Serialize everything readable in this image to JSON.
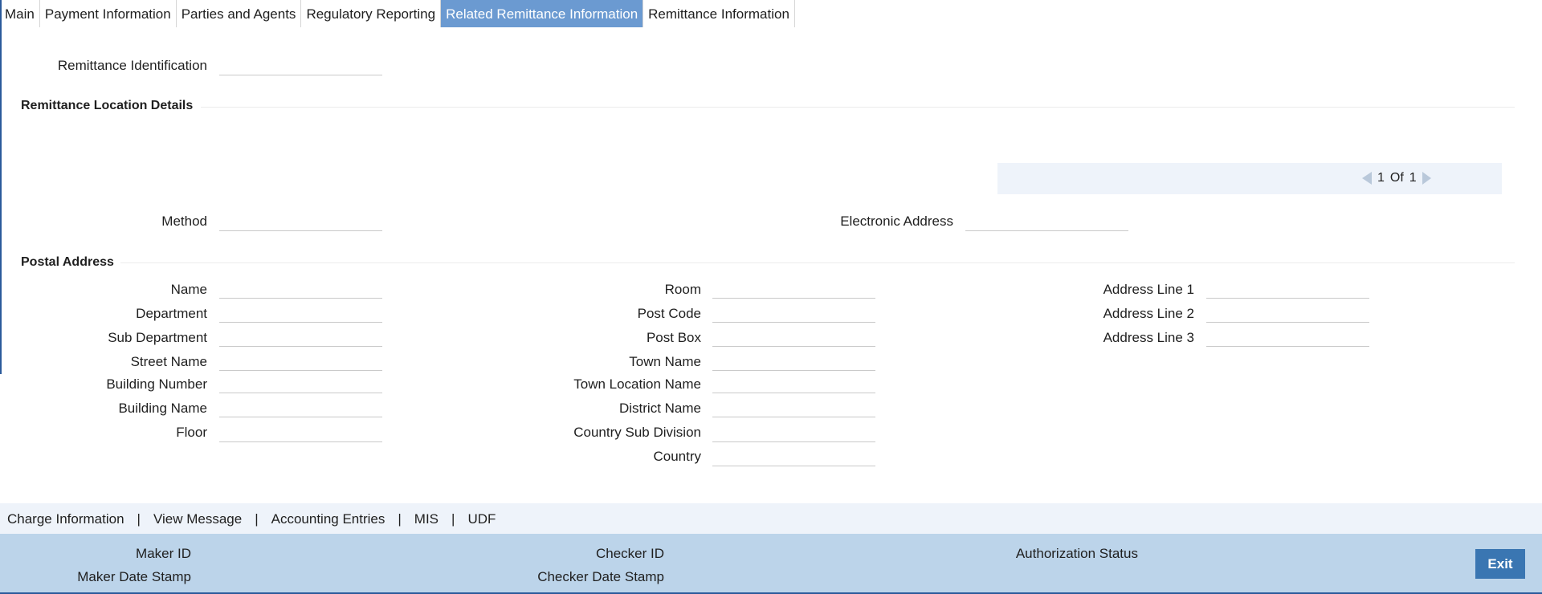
{
  "tabs": [
    {
      "label": "Main",
      "active": false
    },
    {
      "label": "Payment Information",
      "active": false
    },
    {
      "label": "Parties and Agents",
      "active": false
    },
    {
      "label": "Regulatory Reporting",
      "active": false
    },
    {
      "label": "Related Remittance Information",
      "active": true
    },
    {
      "label": "Remittance Information",
      "active": false
    }
  ],
  "remittance": {
    "identification_label": "Remittance Identification",
    "identification_value": ""
  },
  "location": {
    "title": "Remittance Location Details",
    "pager": {
      "current": "1",
      "of_label": "Of",
      "total": "1"
    },
    "method_label": "Method",
    "method_value": "",
    "electronic_address_label": "Electronic Address",
    "electronic_address_value": ""
  },
  "postal": {
    "title": "Postal Address",
    "col1": [
      {
        "label": "Name",
        "value": ""
      },
      {
        "label": "Department",
        "value": ""
      },
      {
        "label": "Sub Department",
        "value": ""
      },
      {
        "label": "Street Name",
        "value": ""
      },
      {
        "label": "Building Number",
        "value": ""
      },
      {
        "label": "Building Name",
        "value": ""
      },
      {
        "label": "Floor",
        "value": ""
      }
    ],
    "col2": [
      {
        "label": "Room",
        "value": ""
      },
      {
        "label": "Post Code",
        "value": ""
      },
      {
        "label": "Post Box",
        "value": ""
      },
      {
        "label": "Town Name",
        "value": ""
      },
      {
        "label": "Town Location Name",
        "value": ""
      },
      {
        "label": "District Name",
        "value": ""
      },
      {
        "label": "Country Sub Division",
        "value": ""
      },
      {
        "label": "Country",
        "value": ""
      }
    ],
    "col3": [
      {
        "label": "Address Line 1",
        "value": ""
      },
      {
        "label": "Address Line 2",
        "value": ""
      },
      {
        "label": "Address Line 3",
        "value": ""
      }
    ]
  },
  "links": {
    "charge_information": "Charge Information",
    "view_message": "View Message",
    "accounting_entries": "Accounting Entries",
    "mis": "MIS",
    "udf": "UDF",
    "separator": "|"
  },
  "footer": {
    "maker_id": "Maker ID",
    "maker_date_stamp": "Maker Date Stamp",
    "checker_id": "Checker ID",
    "checker_date_stamp": "Checker Date Stamp",
    "authorization_status": "Authorization Status",
    "exit_label": "Exit"
  },
  "colors": {
    "active_tab": "#6b9ad1",
    "footer_bg": "#bcd4ea",
    "exit_button": "#3a76b2",
    "link_bar_bg": "#eef3fa"
  }
}
